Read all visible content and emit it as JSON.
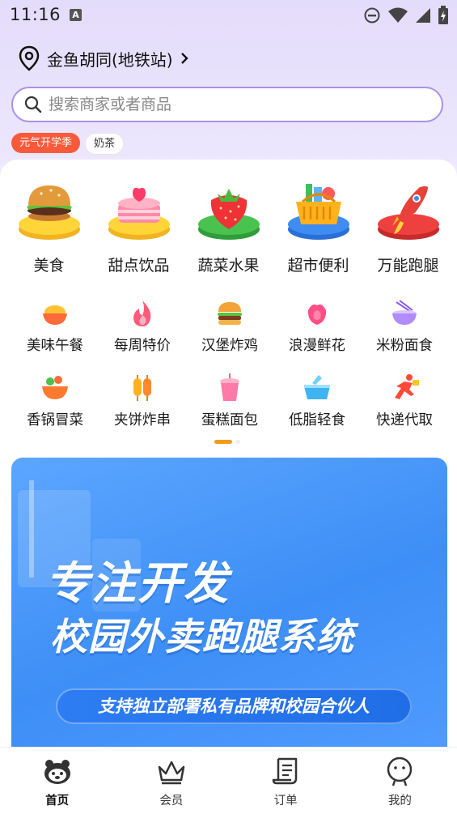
{
  "status_bar": {
    "time": "11:16",
    "notif_letter": "A"
  },
  "location": {
    "text": "金鱼胡同(地铁站)"
  },
  "search": {
    "placeholder": "搜索商家或者商品"
  },
  "tags": [
    {
      "label": "元气开学季"
    },
    {
      "label": "奶茶"
    }
  ],
  "categories_primary": [
    {
      "label": "美食",
      "icon": "burger-icon"
    },
    {
      "label": "甜点饮品",
      "icon": "cake-icon"
    },
    {
      "label": "蔬菜水果",
      "icon": "strawberry-icon"
    },
    {
      "label": "超市便利",
      "icon": "basket-icon"
    },
    {
      "label": "万能跑腿",
      "icon": "rocket-icon"
    }
  ],
  "categories_secondary_row1": [
    {
      "label": "美味午餐",
      "icon": "rice-bowl-icon"
    },
    {
      "label": "每周特价",
      "icon": "flame-icon"
    },
    {
      "label": "汉堡炸鸡",
      "icon": "hamburger-icon"
    },
    {
      "label": "浪漫鲜花",
      "icon": "rose-icon"
    },
    {
      "label": "米粉面食",
      "icon": "noodle-bowl-icon"
    }
  ],
  "categories_secondary_row2": [
    {
      "label": "香锅冒菜",
      "icon": "hotpot-icon"
    },
    {
      "label": "夹饼炸串",
      "icon": "skewer-icon"
    },
    {
      "label": "蛋糕面包",
      "icon": "drink-cup-icon"
    },
    {
      "label": "低脂轻食",
      "icon": "salad-box-icon"
    },
    {
      "label": "快递代取",
      "icon": "runner-icon"
    }
  ],
  "banner": {
    "title_line1": "专注开发",
    "title_line2": "校园外卖跑腿系统",
    "subtitle": "支持独立部署私有品牌和校园合伙人"
  },
  "tabbar": [
    {
      "label": "首页",
      "icon": "home-mascot-icon",
      "active": true
    },
    {
      "label": "会员",
      "icon": "crown-icon",
      "active": false
    },
    {
      "label": "订单",
      "icon": "order-scroll-icon",
      "active": false
    },
    {
      "label": "我的",
      "icon": "profile-icon",
      "active": false
    }
  ],
  "colors": {
    "accent_orange": "#f59a1b",
    "tag_hot": "#fb5a3a",
    "search_border": "#a892e8",
    "banner_blue": "#3d8ef6"
  }
}
